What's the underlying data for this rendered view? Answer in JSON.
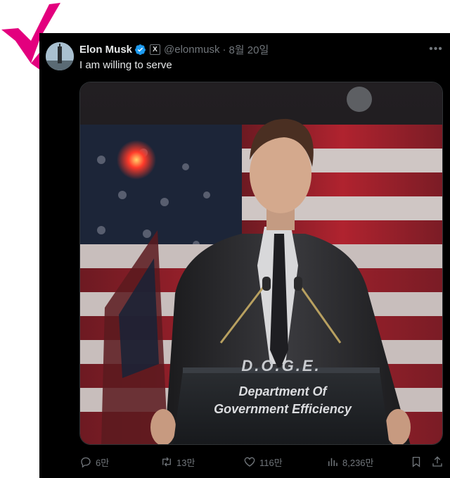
{
  "tweet": {
    "author_name": "Elon Musk",
    "handle": "@elonmusk",
    "separator": "·",
    "date": "8월 20일",
    "x_badge": "X",
    "text": "I am willing to serve",
    "more_icon": "more-icon"
  },
  "image": {
    "podium_letters": "D.O.G.E.",
    "podium_line1": "Department Of",
    "podium_line2": "Government Efficiency"
  },
  "actions": {
    "replies": "6만",
    "reposts": "13만",
    "likes": "116만",
    "views": "8,236만"
  },
  "colors": {
    "background": "#000000",
    "verified": "#1d9bf0",
    "muted_text": "#71767b",
    "pink_check": "#e3007e"
  }
}
